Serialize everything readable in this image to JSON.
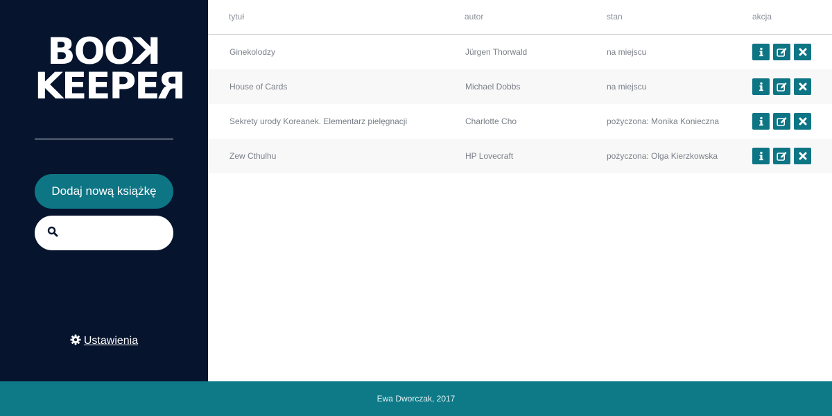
{
  "brand": {
    "logo_line1": "BOOK",
    "logo_line2": "KEEPER"
  },
  "sidebar": {
    "add_button_label": "Dodaj nową książkę",
    "search": {
      "value": "",
      "placeholder": ""
    },
    "settings_label": "Ustawienia"
  },
  "table": {
    "headers": {
      "title": "tytuł",
      "author": "autor",
      "status": "stan",
      "action": "akcja"
    },
    "rows": [
      {
        "title": "Ginekolodzy",
        "author": "Jürgen Thorwald",
        "status": "na miejscu"
      },
      {
        "title": "House of Cards",
        "author": "Michael Dobbs",
        "status": "na miejscu"
      },
      {
        "title": "Sekrety urody Koreanek. Elementarz pielęgnacji",
        "author": "Charlotte Cho",
        "status": "pożyczona: Monika Konieczna"
      },
      {
        "title": "Zew Cthulhu",
        "author": "HP Lovecraft",
        "status": "pożyczona: Olga Kierzkowska"
      }
    ],
    "action_icons": [
      "info-icon",
      "edit-icon",
      "delete-icon"
    ]
  },
  "footer": {
    "text": "Ewa Dworczak, 2017"
  },
  "colors": {
    "sidebar_bg": "#06142e",
    "accent": "#0e7585",
    "footer_bg": "#0e7a88",
    "row_alt": "#f8f8f8"
  }
}
